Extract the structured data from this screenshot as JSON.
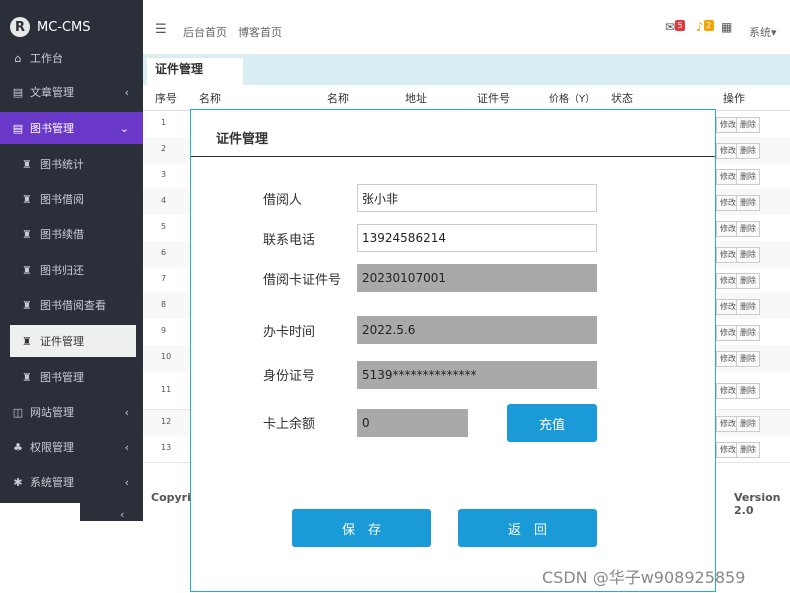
{
  "app": {
    "logo_text": "MC-CMS"
  },
  "sidebar": {
    "items": [
      {
        "label": "工作台",
        "icon": "home-icon"
      },
      {
        "label": "文章管理",
        "icon": "article-icon",
        "arrow": "‹"
      },
      {
        "label": "图书管理",
        "icon": "book-icon",
        "arrow": "⌄"
      },
      {
        "label": "网站管理",
        "icon": "website-icon",
        "arrow": "‹"
      },
      {
        "label": "权限管理",
        "icon": "users-icon",
        "arrow": "‹"
      },
      {
        "label": "系统管理",
        "icon": "gear-icon",
        "arrow": "‹"
      }
    ],
    "subitems": [
      "图书统计",
      "图书借阅",
      "图书续借",
      "图书归还",
      "图书借阅查看",
      "证件管理",
      "图书管理"
    ],
    "bottom_arrow": "‹"
  },
  "topbar": {
    "menu_icon": "☰",
    "links": [
      "后台首页",
      "博客首页"
    ],
    "msg_count": "5",
    "notif_count": "2",
    "user_menu": "系统▾"
  },
  "content": {
    "tab_title": "证件管理",
    "columns": [
      "序号",
      "名称",
      "名称",
      "地址",
      "证件号",
      "价格（Y）",
      "状态",
      "操作"
    ],
    "row_numbers": [
      "1",
      "2",
      "3",
      "4",
      "5",
      "6",
      "7",
      "8",
      "9",
      "10",
      "11",
      "12",
      "13"
    ],
    "edit_label": "修改",
    "delete_label": "删除",
    "footer_left": "Copyrigh",
    "footer_right": "Version 2.0"
  },
  "modal": {
    "title": "证件管理",
    "fields": [
      {
        "label": "借阅人",
        "value": "张小非",
        "readonly": false
      },
      {
        "label": "联系电话",
        "value": "13924586214",
        "readonly": false
      },
      {
        "label": "借阅卡证件号",
        "value": "20230107001",
        "readonly": true
      },
      {
        "label": "办卡时间",
        "value": "2022.5.6",
        "readonly": true
      },
      {
        "label": "身份证号",
        "value": "5139**************",
        "readonly": true
      },
      {
        "label": "卡上余额",
        "value": "0",
        "readonly": true
      }
    ],
    "recharge_label": "充值",
    "save_label": "保　存",
    "back_label": "返　回"
  },
  "watermark": "CSDN @华子w908925859",
  "colors": {
    "sidebar_bg": "#2b2f3a",
    "active_menu": "#6a38c8",
    "button_blue": "#1a9ad6",
    "modal_border": "#22b0c8",
    "readonly_bg": "#a9a9a9"
  }
}
